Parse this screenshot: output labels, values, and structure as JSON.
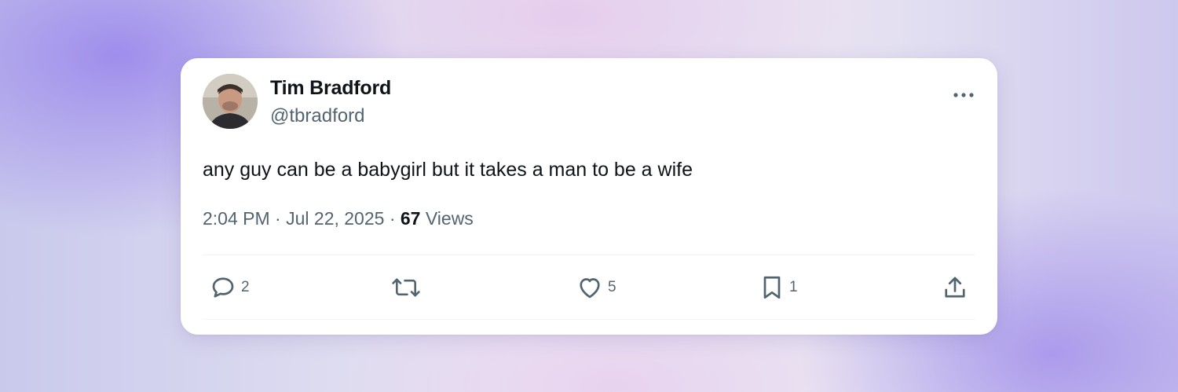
{
  "tweet": {
    "author": {
      "name": "Tim Bradford",
      "handle": "@tbradford",
      "avatar_icon": "profile-photo"
    },
    "menu_icon": "more-options-icon",
    "text": "any guy can be a babygirl but it takes a man to be a wife",
    "time": "2:04 PM",
    "separator": "·",
    "date": "Jul 22, 2025",
    "views_count": "67",
    "views_label": "Views",
    "actions": {
      "reply": {
        "icon": "reply-icon",
        "count": "2"
      },
      "retweet": {
        "icon": "retweet-icon",
        "count": ""
      },
      "like": {
        "icon": "like-icon",
        "count": "5"
      },
      "bookmark": {
        "icon": "bookmark-icon",
        "count": "1"
      },
      "share": {
        "icon": "share-icon",
        "count": ""
      }
    }
  },
  "colors": {
    "primary_text": "#0f1419",
    "secondary_text": "#536471",
    "card_background": "#ffffff",
    "divider": "#eff3f4"
  }
}
